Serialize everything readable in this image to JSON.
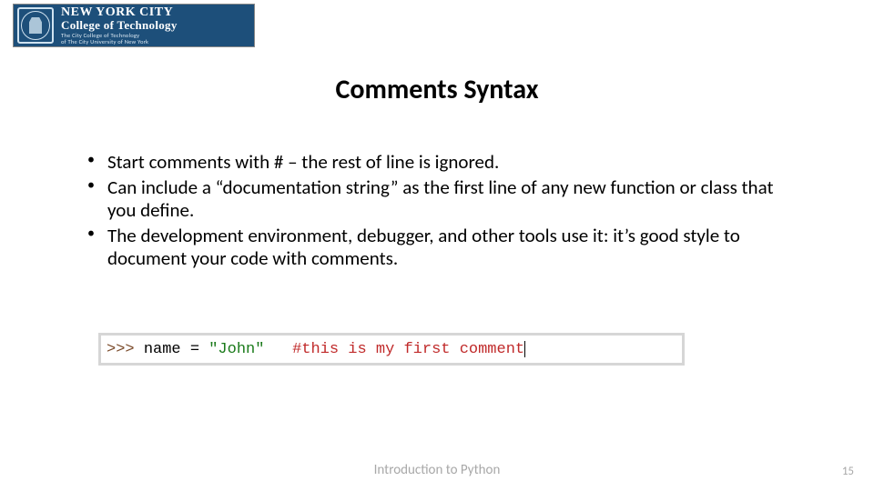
{
  "logo": {
    "line1": "NEW YORK CITY",
    "line2": "College of Technology",
    "line3": "The City College of Technology",
    "line4": "of The City University of New York"
  },
  "title": "Comments Syntax",
  "bullets": [
    {
      "pre": "Start comments with ",
      "hash": "#",
      "post": " – the rest of line is ignored."
    },
    {
      "pre": "Can include a “documentation string” as the first line of any new function or class that you define.",
      "hash": "",
      "post": ""
    },
    {
      "pre": "The development environment, debugger, and other tools use it: it’s good style to document your code with comments.",
      "hash": "",
      "post": ""
    }
  ],
  "code": {
    "prompt": ">>> ",
    "var": "name",
    "eq": " = ",
    "str": "\"John\"",
    "gap": "   ",
    "comment": "#this is my first comment"
  },
  "footer": "Introduction to Python",
  "page": "15"
}
